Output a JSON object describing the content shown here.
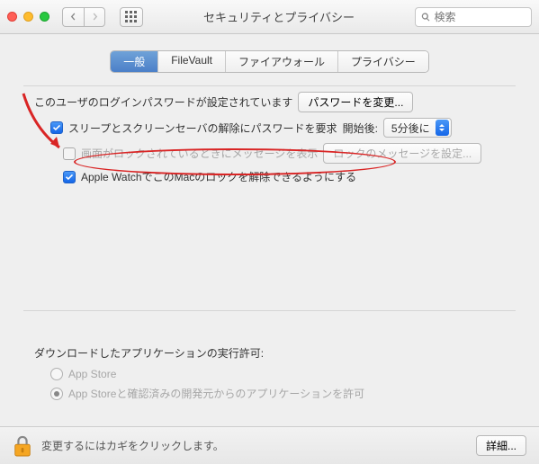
{
  "titlebar": {
    "title": "セキュリティとプライバシー",
    "search_placeholder": "検索"
  },
  "tabs": [
    "一般",
    "FileVault",
    "ファイアウォール",
    "プライバシー"
  ],
  "active_tab_index": 0,
  "login": {
    "text": "このユーザのログインパスワードが設定されています",
    "change_btn": "パスワードを変更..."
  },
  "sleep": {
    "label": "スリープとスクリーンセーバの解除にパスワードを要求",
    "after": "開始後:",
    "delay": "5分後に",
    "checked": true
  },
  "lockmsg": {
    "label": "画面がロックされているときにメッセージを表示",
    "btn": "ロックのメッセージを設定...",
    "checked": false,
    "enabled": false
  },
  "applewatch": {
    "label": "Apple WatchでこのMacのロックを解除できるようにする",
    "checked": true
  },
  "download": {
    "title": "ダウンロードしたアプリケーションの実行許可:",
    "options": [
      "App Store",
      "App Storeと確認済みの開発元からのアプリケーションを許可"
    ],
    "selected_index": 1,
    "enabled": false
  },
  "footer": {
    "msg": "変更するにはカギをクリックします。",
    "advanced": "詳細..."
  }
}
